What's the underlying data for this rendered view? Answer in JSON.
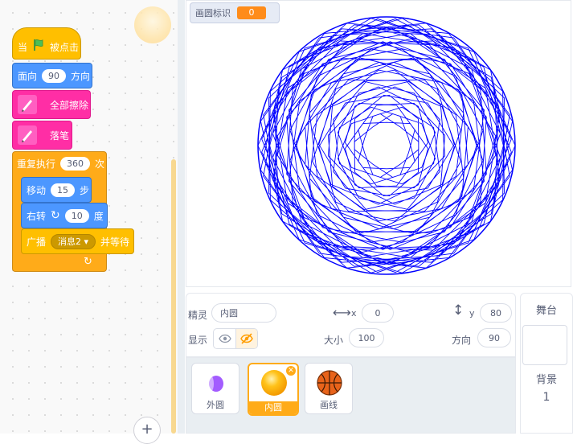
{
  "script": {
    "hat": {
      "label_when": "当",
      "label_clicked": "被点击",
      "flag": "green-flag-icon"
    },
    "point_direction": {
      "label": "面向",
      "value": "90",
      "suffix": "方向"
    },
    "clear": {
      "label": "全部擦除"
    },
    "pen_down": {
      "label": "落笔"
    },
    "repeat": {
      "label": "重复执行",
      "value": "360",
      "suffix": "次"
    },
    "move": {
      "label": "移动",
      "value": "15",
      "suffix": "步"
    },
    "turn": {
      "label": "右转",
      "value": "10",
      "suffix": "度"
    },
    "broadcast": {
      "label": "广播",
      "message": "消息2",
      "suffix": "并等待"
    }
  },
  "zoom": {
    "label": "+"
  },
  "stage": {
    "monitor": {
      "label": "画圆标识",
      "value": "0"
    },
    "drawing_color": "#0000ff"
  },
  "sprite_info": {
    "sprite_label": "精灵",
    "sprite_name": "内圆",
    "x_label": "x",
    "x_value": "0",
    "y_label": "y",
    "y_value": "80",
    "show_label": "显示",
    "size_label": "大小",
    "size_value": "100",
    "direction_label": "方向",
    "direction_value": "90"
  },
  "sprites": [
    {
      "name": "外圆",
      "icon": "purple-ellipse-icon",
      "selected": false
    },
    {
      "name": "内圆",
      "icon": "orange-ball-icon",
      "selected": true
    },
    {
      "name": "画线",
      "icon": "basketball-icon",
      "selected": false
    }
  ],
  "stage_panel": {
    "title": "舞台",
    "backdrop_label": "背景",
    "backdrop_count": "1"
  },
  "colors": {
    "events": "#ffbf00",
    "motion": "#4c97ff",
    "pen": "#ff2ea5",
    "control": "#ffab19",
    "accent": "#ff8c1a"
  }
}
